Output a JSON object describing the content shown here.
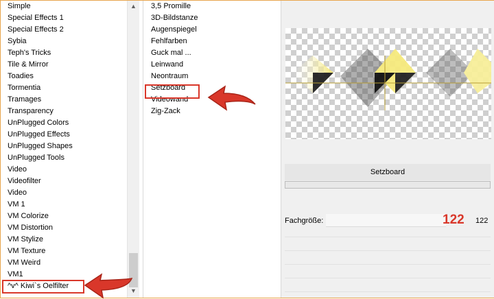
{
  "categories": {
    "items": [
      "Simple",
      "Special Effects 1",
      "Special Effects 2",
      "Sybia",
      "Teph's Tricks",
      "Tile & Mirror",
      "Toadies",
      "Tormentia",
      "Tramages",
      "Transparency",
      "UnPlugged Colors",
      "UnPlugged Effects",
      "UnPlugged Shapes",
      "UnPlugged Tools",
      "Video",
      "Videofilter",
      "Video",
      "VM 1",
      "VM Colorize",
      "VM Distortion",
      "VM Stylize",
      "VM Texture",
      "VM Weird",
      "VM1",
      "^v^ Kiwi`s Oelfilter"
    ],
    "selected": "^v^ Kiwi`s Oelfilter"
  },
  "filters": {
    "items": [
      "3,5 Promille",
      "3D-Bildstanze",
      "Augenspiegel",
      "Fehlfarben",
      "Guck mal ...",
      "Leinwand",
      "Neontraum",
      "Setzboard",
      "Videowand",
      "Zig-Zack"
    ],
    "selected": "Setzboard"
  },
  "preview": {
    "filter_name": "Setzboard",
    "progress": 0
  },
  "parameters": [
    {
      "label": "Fachgröße:",
      "annotation": "122",
      "value": "122"
    }
  ],
  "colors": {
    "highlight": "#d9372a",
    "frame": "#e8a54c"
  },
  "icons": {
    "scroll_up": "scroll-up-arrow-icon",
    "scroll_down": "scroll-down-arrow-icon",
    "pointer": "red-pointer-arrow-icon"
  }
}
